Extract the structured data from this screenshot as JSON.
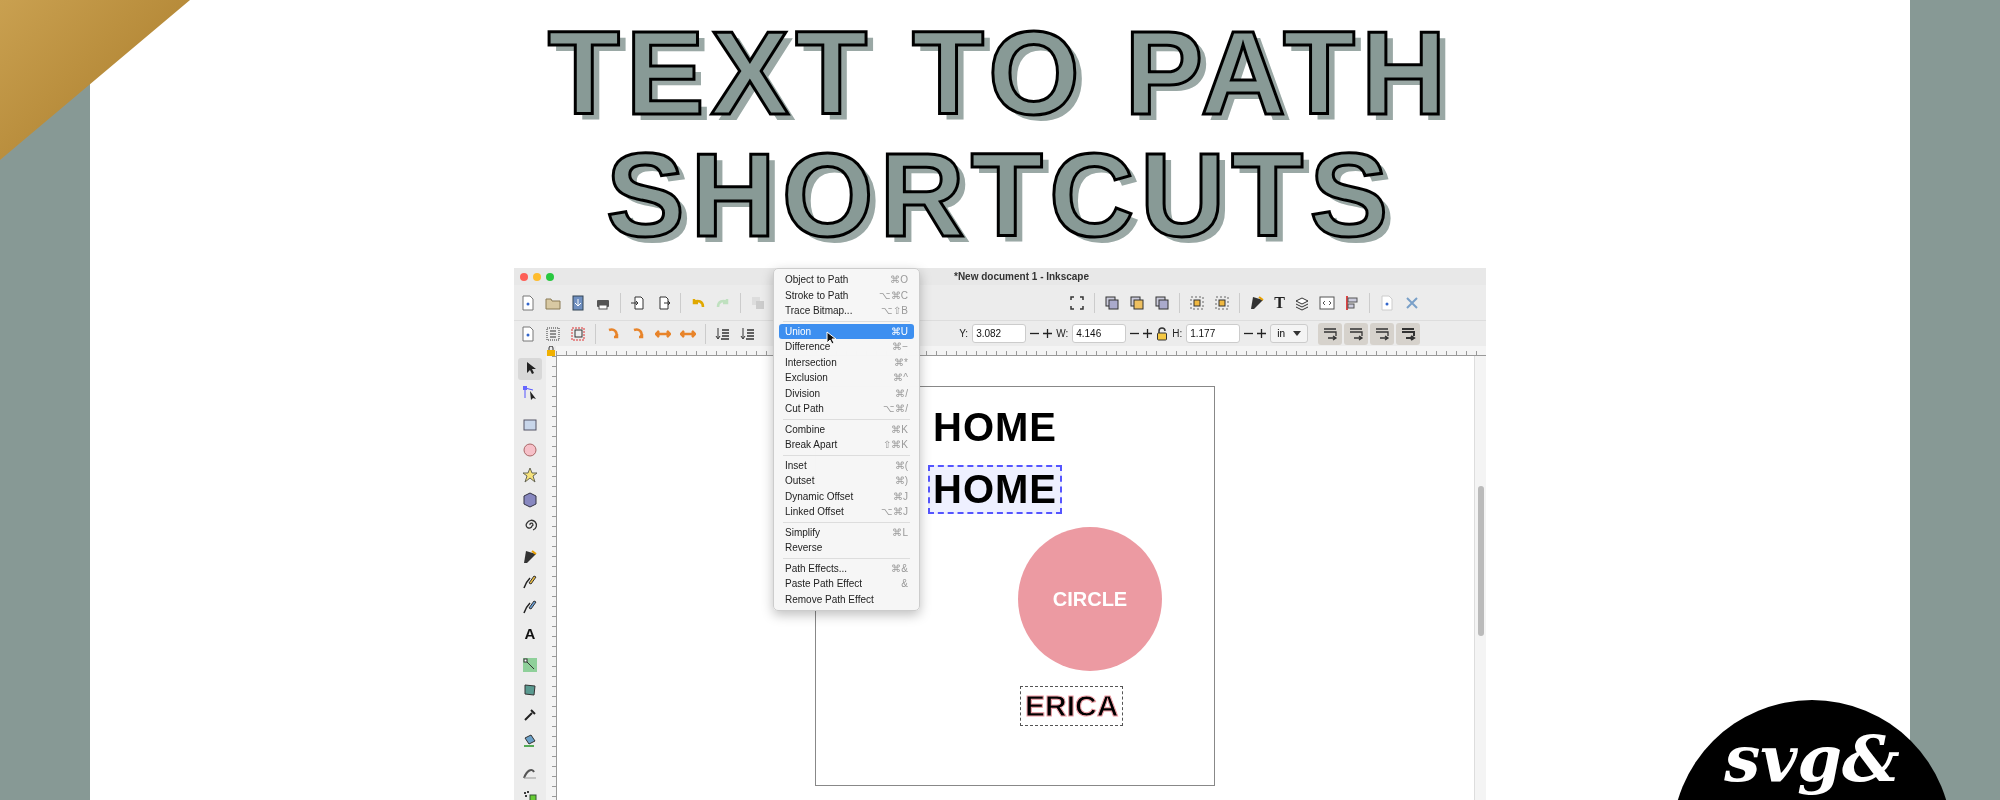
{
  "title_lines": [
    "TEXT TO PATH",
    "SHORTCUTS"
  ],
  "window": {
    "title": "*New document 1 - Inkscape"
  },
  "toolbar_fields": [
    {
      "label": "Y:",
      "value": "3.082"
    },
    {
      "label": "W:",
      "value": "4.146"
    },
    {
      "label": "H:",
      "value": "1.177"
    }
  ],
  "toolbar_text_icon": "T",
  "unit_dropdown": {
    "value": "in"
  },
  "toolbox_text_icon": "A",
  "menu": [
    [
      {
        "label": "Object to Path",
        "shortcut": "⌘O",
        "selected": false
      },
      {
        "label": "Stroke to Path",
        "shortcut": "⌥⌘C",
        "selected": false
      },
      {
        "label": "Trace Bitmap...",
        "shortcut": "⌥⇧B",
        "selected": false
      }
    ],
    [
      {
        "label": "Union",
        "shortcut": "⌘U",
        "selected": true
      },
      {
        "label": "Difference",
        "shortcut": "⌘−",
        "selected": false
      },
      {
        "label": "Intersection",
        "shortcut": "⌘*",
        "selected": false
      },
      {
        "label": "Exclusion",
        "shortcut": "⌘^",
        "selected": false
      },
      {
        "label": "Division",
        "shortcut": "⌘/",
        "selected": false
      },
      {
        "label": "Cut Path",
        "shortcut": "⌥⌘/",
        "selected": false
      }
    ],
    [
      {
        "label": "Combine",
        "shortcut": "⌘K",
        "selected": false
      },
      {
        "label": "Break Apart",
        "shortcut": "⇧⌘K",
        "selected": false
      }
    ],
    [
      {
        "label": "Inset",
        "shortcut": "⌘(",
        "selected": false
      },
      {
        "label": "Outset",
        "shortcut": "⌘)",
        "selected": false
      },
      {
        "label": "Dynamic Offset",
        "shortcut": "⌘J",
        "selected": false
      },
      {
        "label": "Linked Offset",
        "shortcut": "⌥⌘J",
        "selected": false
      }
    ],
    [
      {
        "label": "Simplify",
        "shortcut": "⌘L",
        "selected": false
      },
      {
        "label": "Reverse",
        "selected": false
      }
    ],
    [
      {
        "label": "Path Effects...",
        "shortcut": "⌘&",
        "selected": false
      },
      {
        "label": "Paste Path Effect",
        "shortcut": "&",
        "selected": false
      },
      {
        "label": "Remove Path Effect",
        "selected": false
      }
    ]
  ],
  "canvas": {
    "home_texts": [
      {
        "text": "HOME",
        "selected": false
      },
      {
        "text": "HOME",
        "selected": true
      }
    ],
    "circle_text": "CIRCLE",
    "name_text": {
      "text": "ERICA",
      "selected": true
    }
  },
  "logo": {
    "text": "svg&"
  }
}
